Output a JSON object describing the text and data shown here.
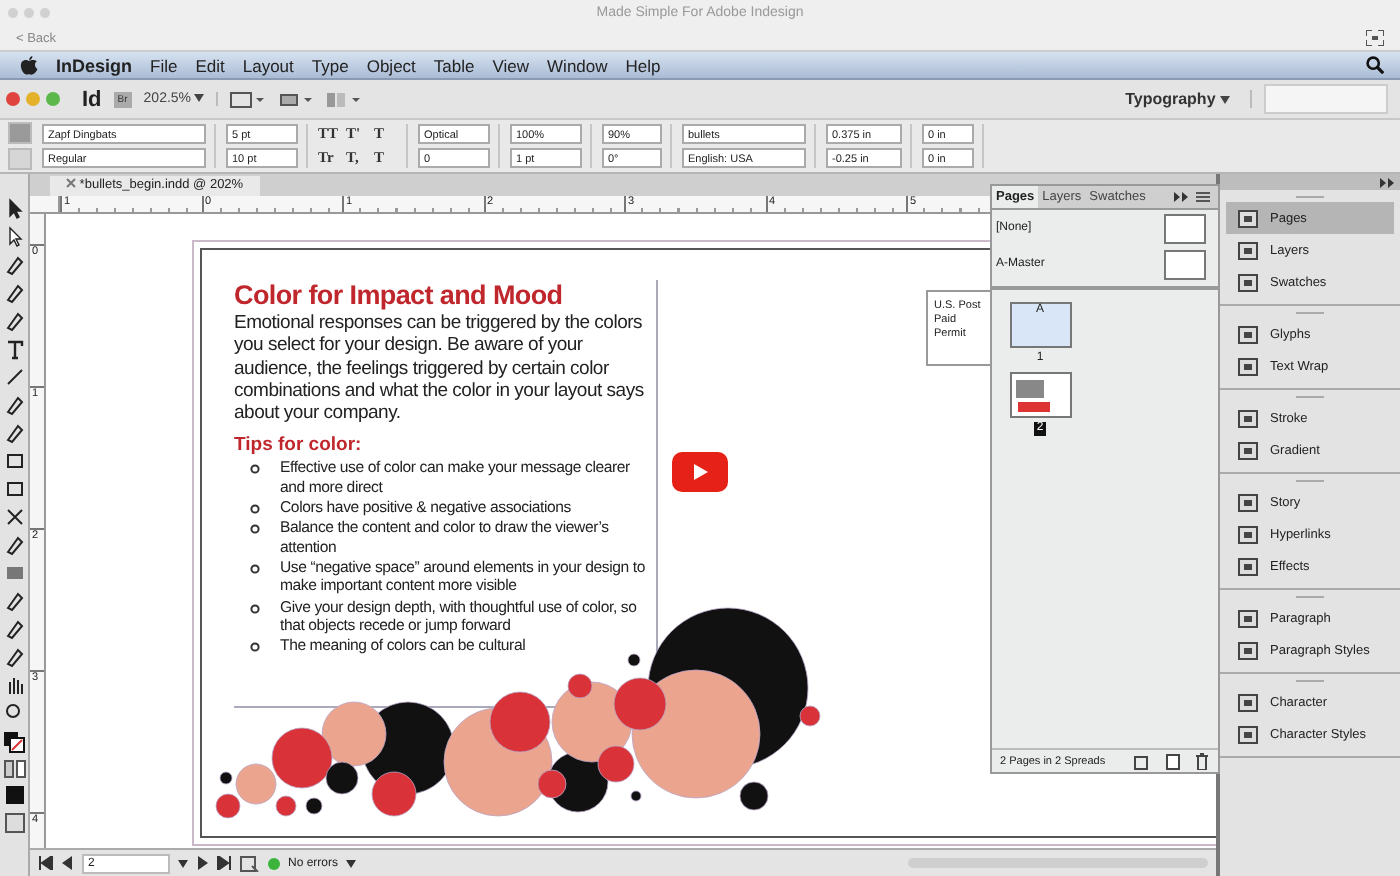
{
  "window": {
    "title": "Made Simple For Adobe Indesign",
    "back_link": "< Back"
  },
  "menu_bar": {
    "app": "InDesign",
    "items": [
      "File",
      "Edit",
      "Layout",
      "Type",
      "Object",
      "Table",
      "View",
      "Window",
      "Help"
    ]
  },
  "app_bar": {
    "logo": "Id",
    "bridge": "Br",
    "zoom": "202.5%",
    "workspace": "Typography"
  },
  "control_panel": {
    "font": "Zapf Dingbats",
    "style": "Regular",
    "size": "5 pt",
    "leading": "10 pt",
    "case_buttons": [
      "TT",
      "T'",
      "T",
      "Tr",
      "T,",
      "T"
    ],
    "kerning": "Optical",
    "tracking": "0",
    "vertical_scale": "100%",
    "baseline_shift": "1 pt",
    "horizontal_scale": "90%",
    "skew": "0°",
    "paragraph_style": "bullets",
    "language": "English: USA",
    "left_indent": "0.375 in",
    "first_line_indent": "-0.25 in",
    "space_before": "0 in",
    "space_after": "0 in"
  },
  "document_tab": {
    "label": "*bullets_begin.indd @ 202%"
  },
  "rulers": {
    "horizontal": [
      "1",
      "0",
      "1",
      "2",
      "3",
      "4",
      "5"
    ],
    "vertical": [
      "0",
      "1",
      "2",
      "3",
      "4"
    ]
  },
  "document": {
    "heading": "Color for Impact and Mood",
    "body": "Emotional responses can be triggered by the colors you select for your design. Be aware of your audience, the feelings triggered by certain color combinations and what the color in your layout says about your company.",
    "subheading": "Tips for color:",
    "bullets": [
      "Effective use of color can make your message clearer and more direct",
      "Colors have positive & negative associations",
      "Balance the content and color to draw the viewer’s attention",
      "Use “negative space” around elements in your design to make important content more visible",
      "Give your design depth, with thoughtful use of color, so that objects recede or jump forward",
      "The meaning of colors can be cultural"
    ],
    "indicia": [
      "U.S. Post",
      "Paid",
      "Permit"
    ]
  },
  "pages_panel": {
    "tabs": [
      {
        "label": "Pages",
        "selected": true
      },
      {
        "label": "Layers",
        "selected": false
      },
      {
        "label": "Swatches",
        "selected": false
      }
    ],
    "masters": [
      "[None]",
      "A-Master"
    ],
    "pages": [
      {
        "label": "1",
        "master": "A",
        "selected": true,
        "current": false
      },
      {
        "label": "2",
        "selected": false,
        "current": true
      }
    ],
    "footer": "2 Pages in 2 Spreads"
  },
  "dock": {
    "groups": [
      [
        {
          "label": "Pages",
          "selected": true
        },
        {
          "label": "Layers",
          "selected": false
        },
        {
          "label": "Swatches",
          "selected": false
        }
      ],
      [
        {
          "label": "Glyphs",
          "selected": false
        },
        {
          "label": "Text Wrap",
          "selected": false
        }
      ],
      [
        {
          "label": "Stroke",
          "selected": false
        },
        {
          "label": "Gradient",
          "selected": false
        }
      ],
      [
        {
          "label": "Story",
          "selected": false
        },
        {
          "label": "Hyperlinks",
          "selected": false
        },
        {
          "label": "Effects",
          "selected": false
        }
      ],
      [
        {
          "label": "Paragraph",
          "selected": false
        },
        {
          "label": "Paragraph Styles",
          "selected": false
        }
      ],
      [
        {
          "label": "Character",
          "selected": false
        },
        {
          "label": "Character Styles",
          "selected": false
        }
      ]
    ]
  },
  "status_bar": {
    "page": "2",
    "preflight": "No errors"
  }
}
